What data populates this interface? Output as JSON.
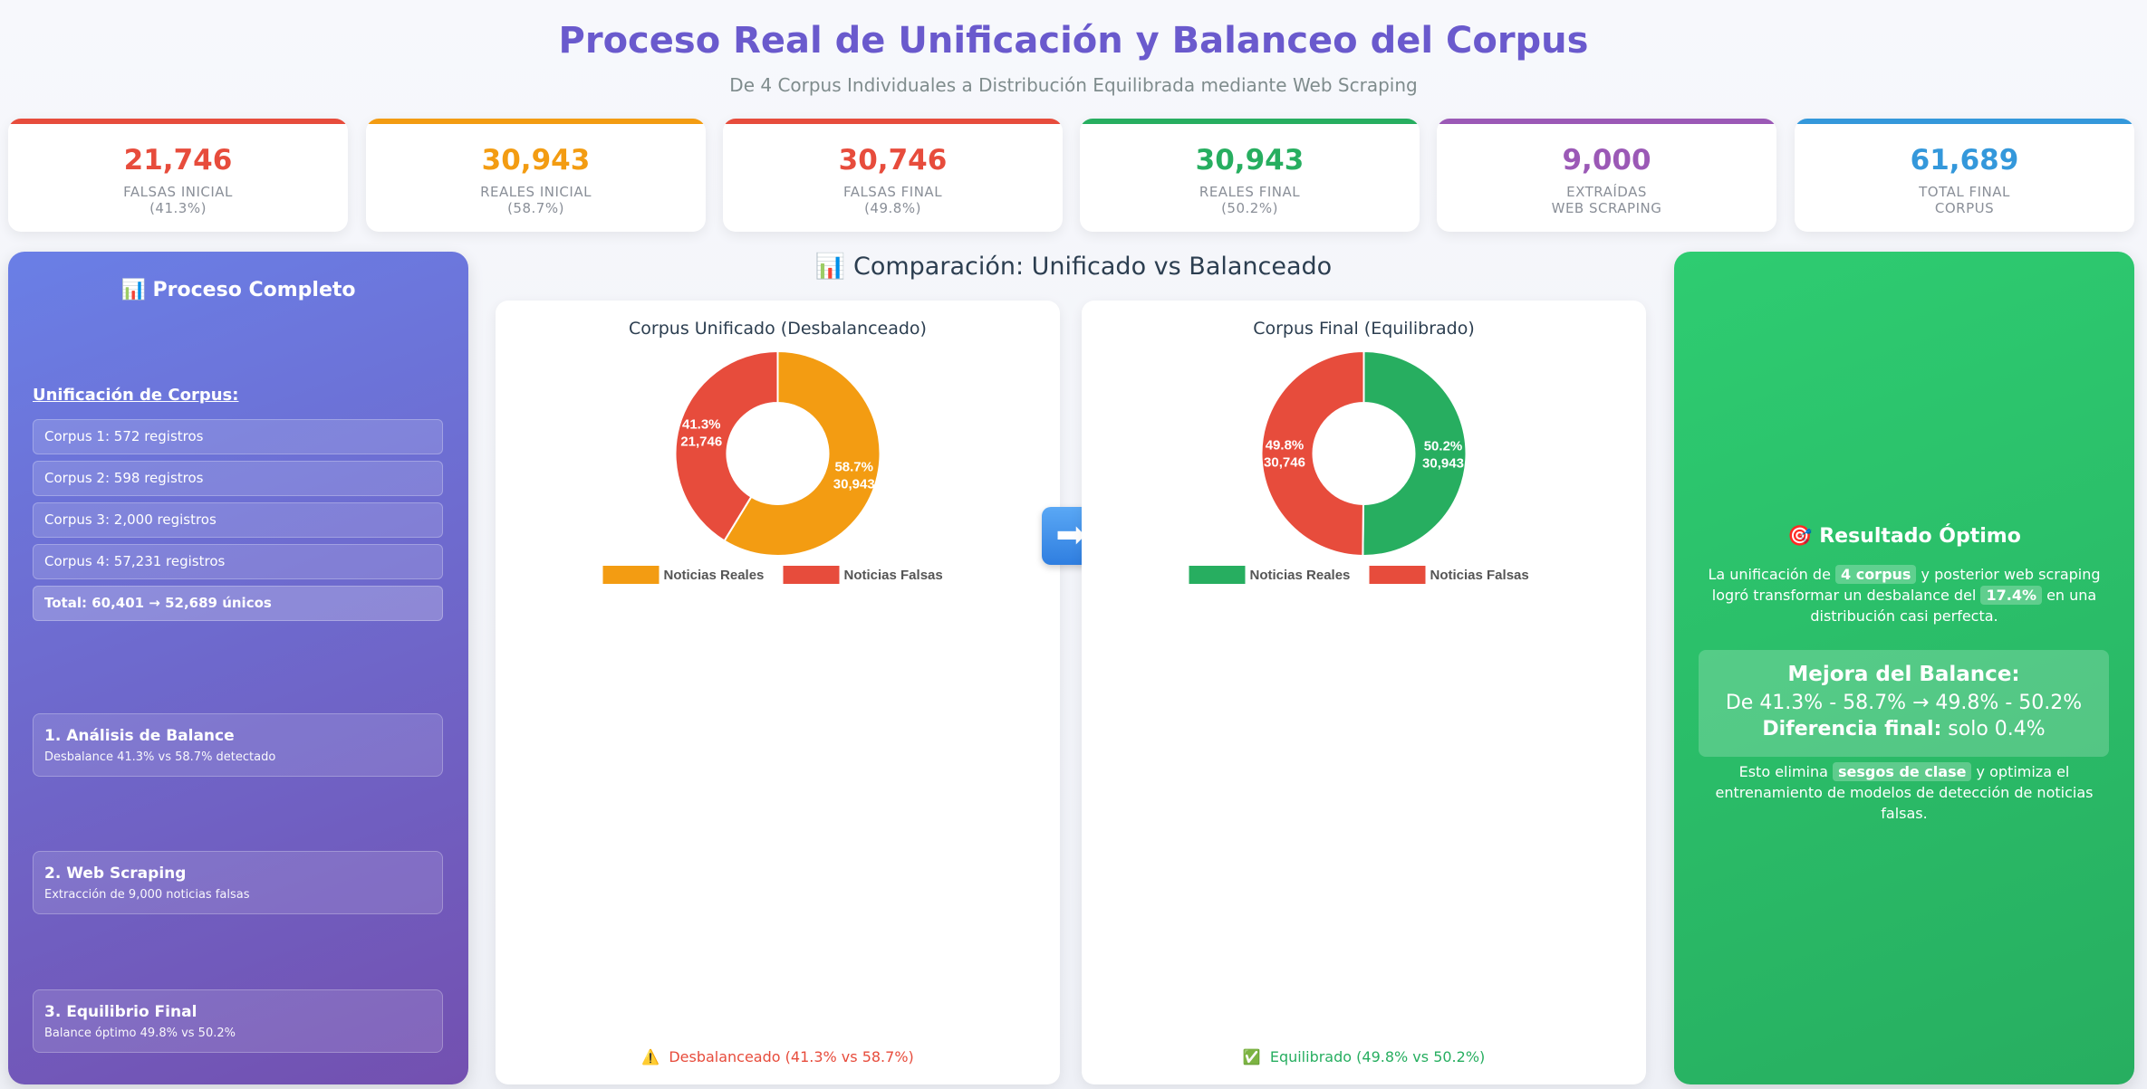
{
  "header": {
    "title": "Proceso Real de Unificación y Balanceo del Corpus",
    "subtitle": "De 4 Corpus Individuales a Distribución Equilibrada mediante Web Scraping"
  },
  "stats": [
    {
      "value": "21,746",
      "label1": "FALSAS INICIAL",
      "label2": "(41.3%)",
      "color": "#e74c3c"
    },
    {
      "value": "30,943",
      "label1": "REALES INICIAL",
      "label2": "(58.7%)",
      "color": "#f39c12"
    },
    {
      "value": "30,746",
      "label1": "FALSAS FINAL",
      "label2": "(49.8%)",
      "color": "#e74c3c"
    },
    {
      "value": "30,943",
      "label1": "REALES FINAL",
      "label2": "(50.2%)",
      "color": "#27ae60"
    },
    {
      "value": "9,000",
      "label1": "EXTRAÍDAS",
      "label2": "WEB SCRAPING",
      "color": "#9b59b6"
    },
    {
      "value": "61,689",
      "label1": "TOTAL FINAL",
      "label2": "CORPUS",
      "color": "#3498db"
    }
  ],
  "left": {
    "title": "📊 Proceso Completo",
    "union_label": "Unificación de Corpus:",
    "corpus": [
      "Corpus 1: 572 registros",
      "Corpus 2: 598 registros",
      "Corpus 3: 2,000 registros",
      "Corpus 4: 57,231 registros"
    ],
    "total": "Total: 60,401 → 52,689 únicos",
    "steps": [
      {
        "title": "1. Análisis de Balance",
        "desc": "Desbalance 41.3% vs 58.7% detectado"
      },
      {
        "title": "2. Web Scraping",
        "desc": "Extracción de 9,000 noticias falsas"
      },
      {
        "title": "3. Equilibrio Final",
        "desc": "Balance óptimo 49.8% vs 50.2%"
      }
    ]
  },
  "center": {
    "title": "📊 Comparación: Unificado vs Balanceado",
    "arrow": "➡"
  },
  "chart_data": [
    {
      "type": "pie",
      "title": "Corpus Unificado (Desbalanceado)",
      "series": [
        {
          "name": "Noticias Reales",
          "value": 30943,
          "pct": "58.7%",
          "label": "30,943",
          "color": "#f39c12"
        },
        {
          "name": "Noticias Falsas",
          "value": 21746,
          "pct": "41.3%",
          "label": "21,746",
          "color": "#e74c3c"
        }
      ],
      "status": "Desbalanceado (41.3% vs 58.7%)",
      "status_icon": "⚠️",
      "status_color": "#e74c3c",
      "legend": "bottom"
    },
    {
      "type": "pie",
      "title": "Corpus Final (Equilibrado)",
      "series": [
        {
          "name": "Noticias Reales",
          "value": 30943,
          "pct": "50.2%",
          "label": "30,943",
          "color": "#27ae60"
        },
        {
          "name": "Noticias Falsas",
          "value": 30746,
          "pct": "49.8%",
          "label": "30,746",
          "color": "#e74c3c"
        }
      ],
      "status": "Equilibrado (49.8% vs 50.2%)",
      "status_icon": "✅",
      "status_color": "#27ae60",
      "legend": "bottom"
    }
  ],
  "right": {
    "title": "🎯 Resultado Óptimo",
    "p1_a": "La unificación de ",
    "p1_h1": "4 corpus",
    "p1_b": " y posterior web scraping logró transformar un desbalance del ",
    "p1_h2": "17.4%",
    "p1_c": " en una distribución casi perfecta.",
    "m1": "Mejora del Balance:",
    "m2": "De 41.3% - 58.7% → 49.8% - 50.2%",
    "m3_b": "Diferencia final:",
    "m3_t": " solo 0.4%",
    "p2_a": "Esto elimina ",
    "p2_h": "sesgos de clase",
    "p2_b": " y optimiza el entrenamiento de modelos de detección de noticias falsas."
  }
}
